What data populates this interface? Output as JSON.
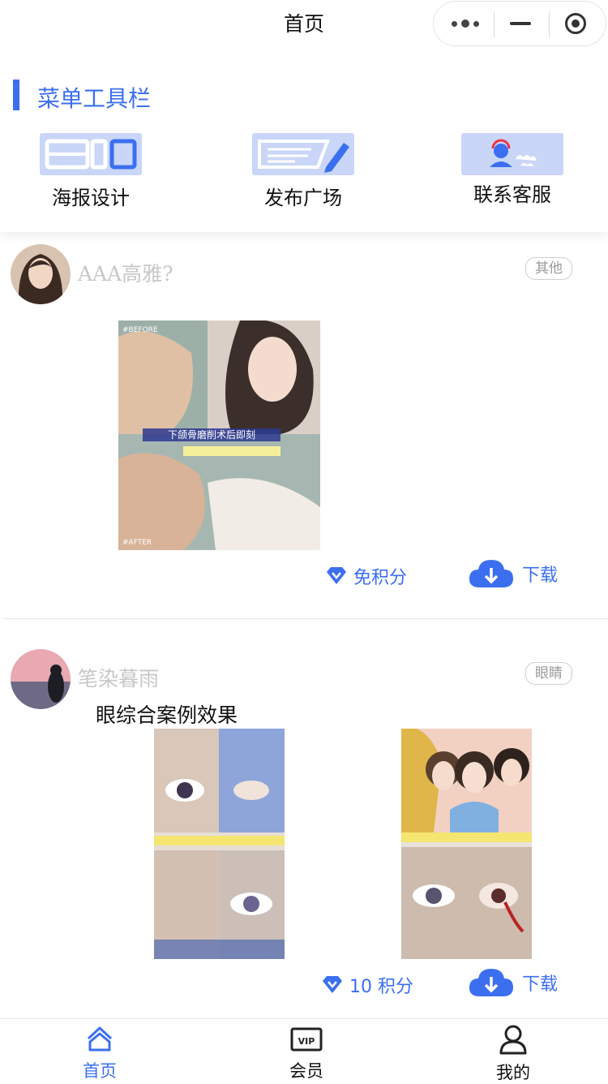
{
  "nav": {
    "title": "首页"
  },
  "menu": {
    "title": "菜单工具栏",
    "tools": [
      {
        "label": "海报设计",
        "icon": "poster-layout-icon"
      },
      {
        "label": "发布广场",
        "icon": "publish-edit-icon"
      },
      {
        "label": "联系客服",
        "icon": "customer-service-icon"
      }
    ]
  },
  "posts": [
    {
      "username": "AAA高雅?",
      "tag": "其他",
      "caption": "",
      "points": "免积分",
      "download": "下载",
      "image_texts": [
        "#BEFORE",
        "#AFTER",
        "下颌骨磨削术后即刻"
      ]
    },
    {
      "username": "笔染暮雨",
      "tag": "眼睛",
      "caption": "眼综合案例效果",
      "points": "10 积分",
      "download": "下载"
    }
  ],
  "tabbar": {
    "items": [
      {
        "label": "首页",
        "active": true
      },
      {
        "label": "会员",
        "active": false
      },
      {
        "label": "我的",
        "active": false
      }
    ]
  },
  "colors": {
    "accent": "#3b6ff0",
    "icon_bg": "#c9d6f8"
  }
}
